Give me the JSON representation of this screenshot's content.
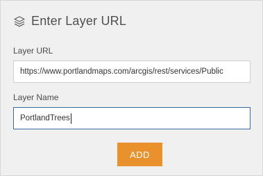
{
  "header": {
    "title": "Enter Layer URL",
    "icon": "layers-icon"
  },
  "url_field": {
    "label": "Layer URL",
    "value": "https://www.portlandmaps.com/arcgis/rest/services/Public"
  },
  "name_field": {
    "label": "Layer Name",
    "value": "PortlandTrees"
  },
  "actions": {
    "add_label": "ADD"
  },
  "colors": {
    "accent": "#e8912d",
    "focus_border": "#3b6aa0"
  }
}
